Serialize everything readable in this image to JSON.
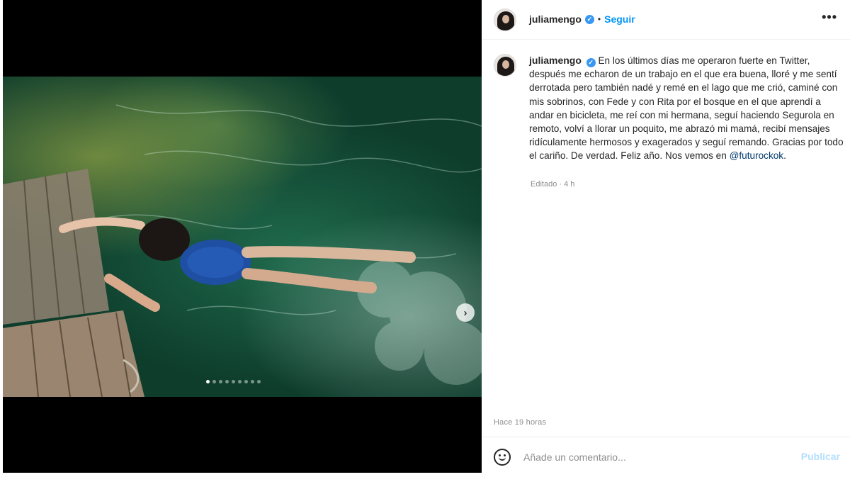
{
  "post": {
    "username": "juliamengo",
    "follow_label": "Seguir",
    "bullet": "•",
    "more_label": "•••",
    "caption": "En los últimos días me operaron fuerte en Twitter, después me echaron de un trabajo en el que era buena, lloré y me sentí derrotada pero también nadé y remé en el lago que me crió, caminé con mis sobrinos, con Fede y con Rita por el bosque en el que aprendí a andar en bicicleta, me reí con mi hermana, seguí haciendo Segurola en remoto, volví a llorar un poquito, me abrazó mi mamá, recibí mensajes ridículamente hermosos y exagerados y seguí remando. Gracias por todo el cariño. De verdad. Feliz año. Nos vemos en ",
    "mention": "@futurockok",
    "mention_suffix": ".",
    "edited_label": "Editado · 4 h",
    "time_label": "Hace 19 horas"
  },
  "carousel": {
    "total_slides": 9,
    "active_index": 0,
    "next_label": "›"
  },
  "comment": {
    "placeholder": "Añade un comentario...",
    "publish_label": "Publicar"
  },
  "colors": {
    "accent": "#0095f6",
    "verified": "#3897f0",
    "publish_disabled": "#b2dffc"
  },
  "icons": {
    "verified": "verified-badge-icon",
    "more": "more-options-icon",
    "emoji": "emoji-icon",
    "next": "chevron-right-icon"
  }
}
